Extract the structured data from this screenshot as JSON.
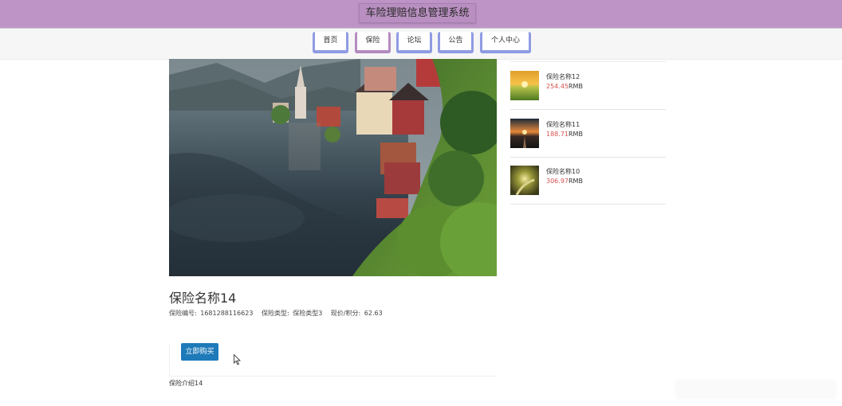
{
  "header": {
    "site_title": "车险理赔信息管理系统"
  },
  "nav": {
    "items": [
      {
        "label": "首页"
      },
      {
        "label": "保险"
      },
      {
        "label": "论坛"
      },
      {
        "label": "公告"
      },
      {
        "label": "个人中心"
      }
    ],
    "active_index": 1
  },
  "detail": {
    "title": "保险名称14",
    "code_label": "保险编号:",
    "code_value": "1681288116623",
    "type_label": "保险类型:",
    "type_value": "保险类型3",
    "price_label": "现价/积分:",
    "price_value": "62.63",
    "buy_label": "立即购买",
    "intro": "保险介绍14"
  },
  "recommend": [
    {
      "name": "保险名称12",
      "price": "254.45",
      "unit": "RMB",
      "thumb_icon": "sunset-field-icon"
    },
    {
      "name": "保险名称11",
      "price": "188.71",
      "unit": "RMB",
      "thumb_icon": "sunset-road-icon"
    },
    {
      "name": "保险名称10",
      "price": "306.97",
      "unit": "RMB",
      "thumb_icon": "sunlit-path-icon"
    }
  ],
  "colors": {
    "header_bg": "#be94c6",
    "nav_accent": "#8f9ce3",
    "nav_active_accent": "#b48bc0",
    "buy_button": "#1e7ab8",
    "price_red": "#d9534f"
  }
}
